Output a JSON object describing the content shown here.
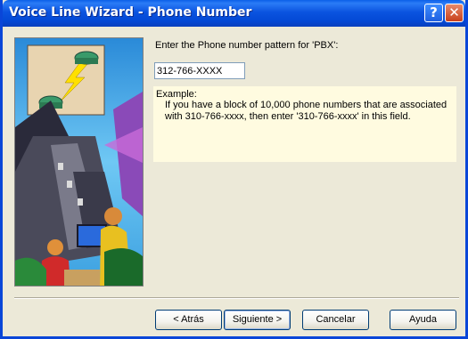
{
  "window": {
    "title": "Voice Line Wizard - Phone Number",
    "help_glyph": "?",
    "close_glyph": "✕"
  },
  "form": {
    "prompt_label": "Enter the Phone number pattern for 'PBX':",
    "pattern_value": "312-766-XXXX"
  },
  "example": {
    "heading": "Example:",
    "body": "If you have a block of 10,000 phone numbers that are associated with 310-766-xxxx, then enter '310-766-xxxx' in this field."
  },
  "buttons": {
    "back": "< Atrás",
    "next": "Siguiente >",
    "cancel": "Cancelar",
    "help": "Ayuda"
  },
  "colors": {
    "titlebar": "#0054e3",
    "dialog_bg": "#ece9d8",
    "example_bg": "#fffbe0"
  },
  "icons": [
    "help-icon",
    "close-icon",
    "wizard-illustration"
  ]
}
